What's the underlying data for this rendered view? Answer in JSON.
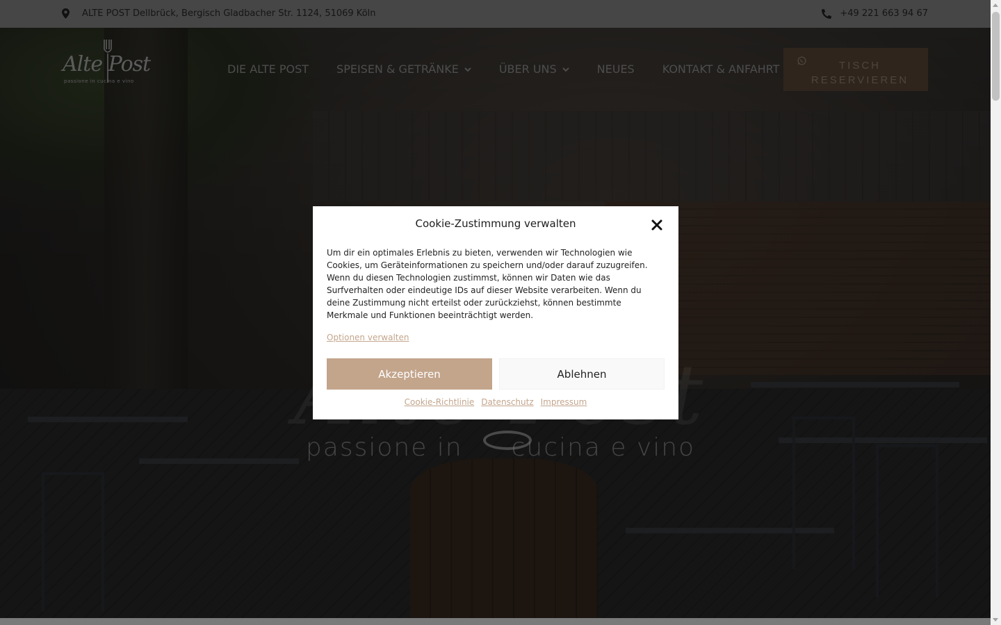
{
  "topbar": {
    "address": "ALTE POST Dellbrück, Bergisch Gladbacher Str. 1124, 51069 Köln",
    "address_icon": "map-marker-icon",
    "phone": "+49 221 663 94 67",
    "phone_icon": "phone-icon"
  },
  "logo": {
    "name": "Alte Post",
    "subtitle": "passione in cucina e vino"
  },
  "nav": {
    "items": [
      {
        "label": "DIE ALTE POST",
        "has_dropdown": false
      },
      {
        "label": "SPEISEN & GETRÄNKE",
        "has_dropdown": true
      },
      {
        "label": "ÜBER UNS",
        "has_dropdown": true
      },
      {
        "label": "NEUES",
        "has_dropdown": false
      },
      {
        "label": "KONTAKT & ANFAHRT",
        "has_dropdown": false
      }
    ],
    "reserve_label": "TISCH RESERVIEREN",
    "reserve_icon": "whatsapp-icon"
  },
  "hero": {
    "logo_script": "Alte Post",
    "tagline_left": "passione in",
    "tagline_right": "cucina e vino"
  },
  "cookie_modal": {
    "title": "Cookie-Zustimmung verwalten",
    "body": "Um dir ein optimales Erlebnis zu bieten, verwenden wir Technologien wie Cookies, um Geräteinformationen zu speichern und/oder darauf zuzugreifen. Wenn du diesen Technologien zustimmst, können wir Daten wie das Surfverhalten oder eindeutige IDs auf dieser Website verarbeiten. Wenn du deine Zustimmung nicht erteilst oder zurückziehst, können bestimmte Merkmale und Funktionen beeinträchtigt werden.",
    "options_link": "Optionen verwalten",
    "accept_label": "Akzeptieren",
    "deny_label": "Ablehnen",
    "footer_links": [
      "Cookie-Richtlinie",
      "Datenschutz",
      "Impressum"
    ]
  },
  "colors": {
    "accent": "#c3a58c",
    "reserve_bg": "#5e4a3a",
    "topbar_bg": "#8c8c8c"
  }
}
